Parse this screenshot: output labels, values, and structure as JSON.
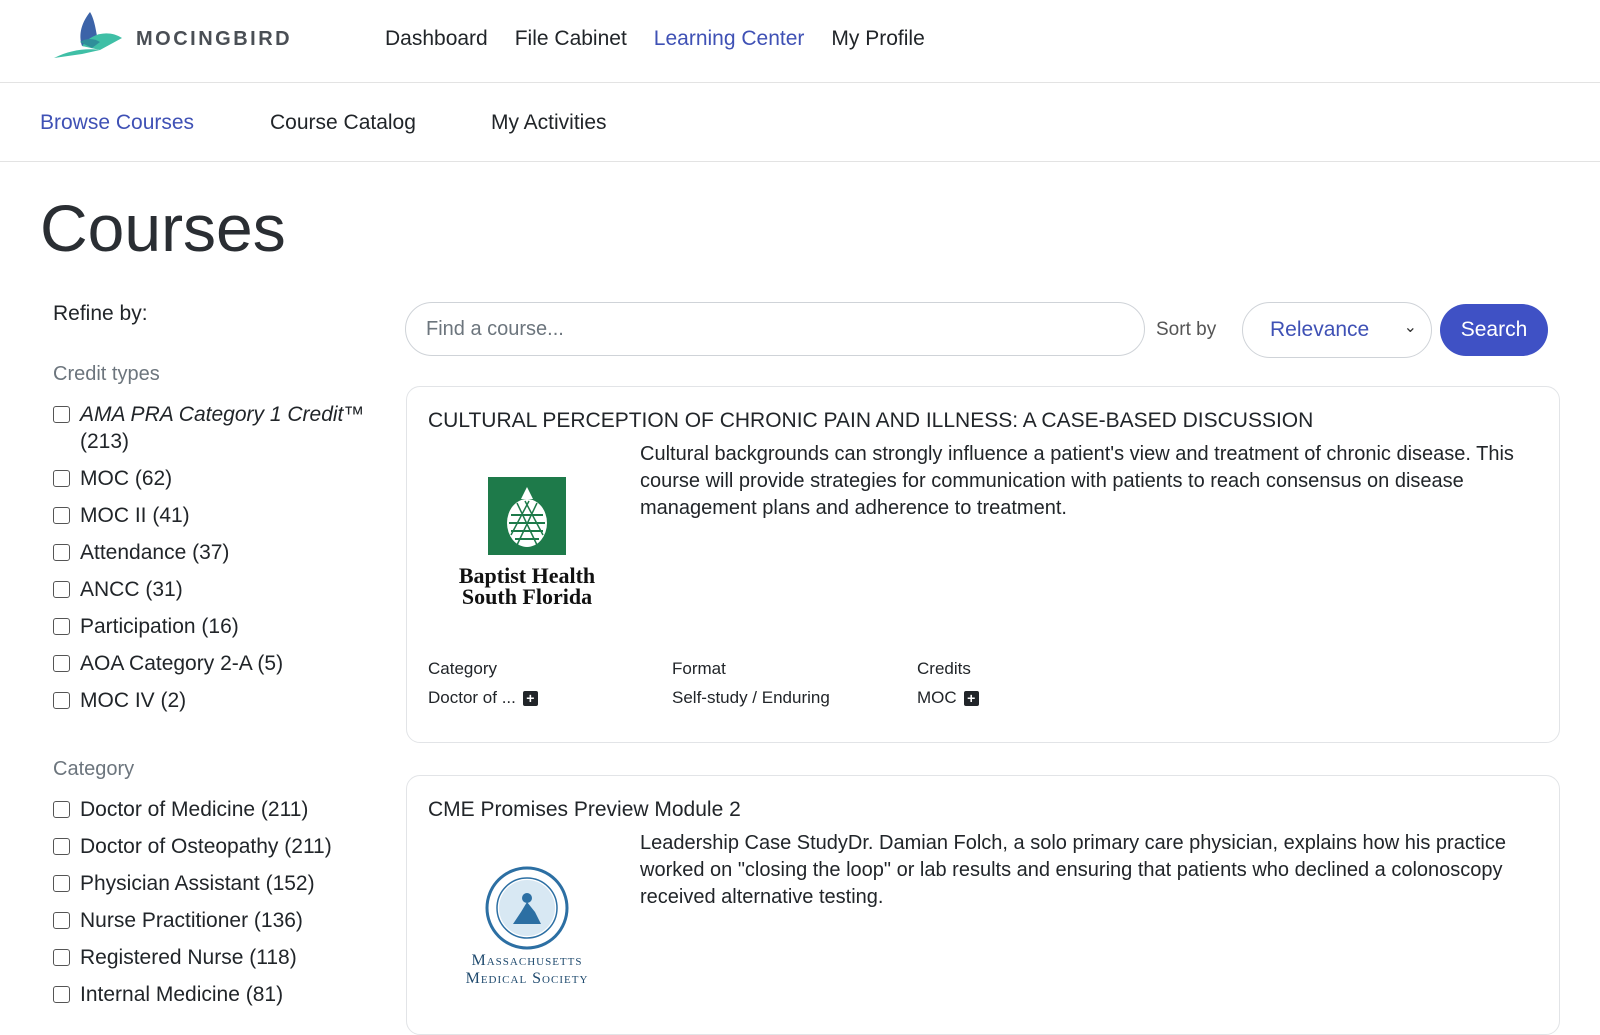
{
  "brand": {
    "name": "MOCINGBIRD",
    "colors": {
      "accent": "#3f51b5",
      "logo_teal": "#3fbfa6",
      "logo_blue": "#3c63a8"
    }
  },
  "main_nav": [
    {
      "label": "Dashboard"
    },
    {
      "label": "File Cabinet"
    },
    {
      "label": "Learning Center",
      "active": true
    },
    {
      "label": "My Profile"
    }
  ],
  "sub_nav": [
    {
      "label": "Browse Courses",
      "active": true
    },
    {
      "label": "Course Catalog"
    },
    {
      "label": "My Activities"
    }
  ],
  "page_title": "Courses",
  "sidebar": {
    "refine_label": "Refine by:",
    "credit_types": {
      "title": "Credit types",
      "items": [
        {
          "label": "AMA PRA Category 1 Credit™",
          "count": "(213)",
          "checked": false
        },
        {
          "label": "MOC (62)",
          "checked": false
        },
        {
          "label": "MOC II (41)",
          "checked": false
        },
        {
          "label": "Attendance (37)",
          "checked": false
        },
        {
          "label": "ANCC (31)",
          "checked": false
        },
        {
          "label": "Participation (16)",
          "checked": false
        },
        {
          "label": "AOA Category 2-A (5)",
          "checked": false
        },
        {
          "label": "MOC IV (2)",
          "checked": false
        }
      ]
    },
    "category": {
      "title": "Category",
      "items": [
        {
          "label": "Doctor of Medicine (211)",
          "checked": false
        },
        {
          "label": "Doctor of Osteopathy (211)",
          "checked": false
        },
        {
          "label": "Physician Assistant (152)",
          "checked": false
        },
        {
          "label": "Nurse Practitioner (136)",
          "checked": false
        },
        {
          "label": "Registered Nurse (118)",
          "checked": false
        },
        {
          "label": "Internal Medicine (81)",
          "checked": false
        }
      ]
    }
  },
  "search": {
    "placeholder": "Find a course...",
    "value": "",
    "sort_label": "Sort by",
    "sort_value": "Relevance",
    "button_label": "Search"
  },
  "courses": [
    {
      "title": "CULTURAL PERCEPTION OF CHRONIC PAIN AND ILLNESS: A CASE-BASED DISCUSSION",
      "description": "Cultural backgrounds can strongly influence a patient's view and treatment of chronic disease. This course will provide strategies for communication with patients to reach consensus on disease management plans and adherence to treatment.",
      "logo_line1": "Baptist Health",
      "logo_line2": "South Florida",
      "meta": {
        "category_label": "Category",
        "category_value": "Doctor of ...",
        "format_label": "Format",
        "format_value": "Self-study / Enduring",
        "credits_label": "Credits",
        "credits_value": "MOC"
      }
    },
    {
      "title": "CME Promises Preview Module 2",
      "description": "Leadership Case StudyDr. Damian Folch, a solo primary care physician, explains how his practice worked on \"closing the loop\" or lab results and ensuring that patients who declined a colonoscopy received alternative testing.",
      "logo_line1": "Massachusetts",
      "logo_line2": "Medical Society"
    }
  ]
}
